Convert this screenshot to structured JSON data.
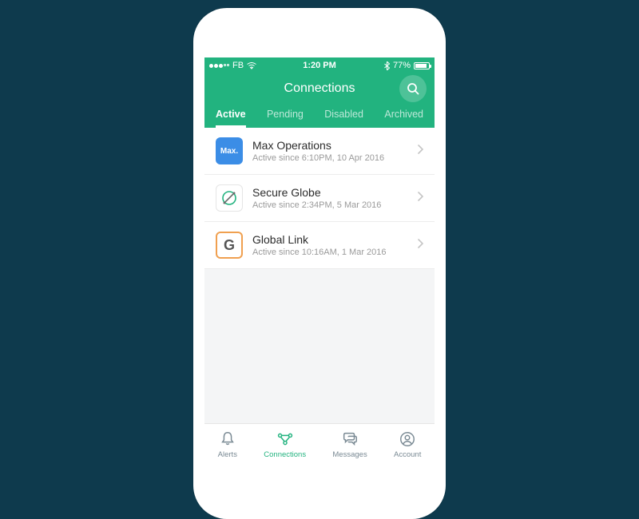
{
  "status": {
    "carrier": "FB",
    "time": "1:20 PM",
    "battery": "77%"
  },
  "header": {
    "title": "Connections"
  },
  "tabs": [
    "Active",
    "Pending",
    "Disabled",
    "Archived"
  ],
  "activeTab": 0,
  "connections": [
    {
      "title": "Max Operations",
      "sub": "Active since 6:10PM, 10 Apr 2016"
    },
    {
      "title": "Secure Globe",
      "sub": "Active since 2:34PM, 5 Mar 2016"
    },
    {
      "title": "Global Link",
      "sub": "Active since 10:16AM, 1 Mar 2016"
    }
  ],
  "nav": {
    "alerts": "Alerts",
    "connections": "Connections",
    "messages": "Messages",
    "account": "Account"
  }
}
